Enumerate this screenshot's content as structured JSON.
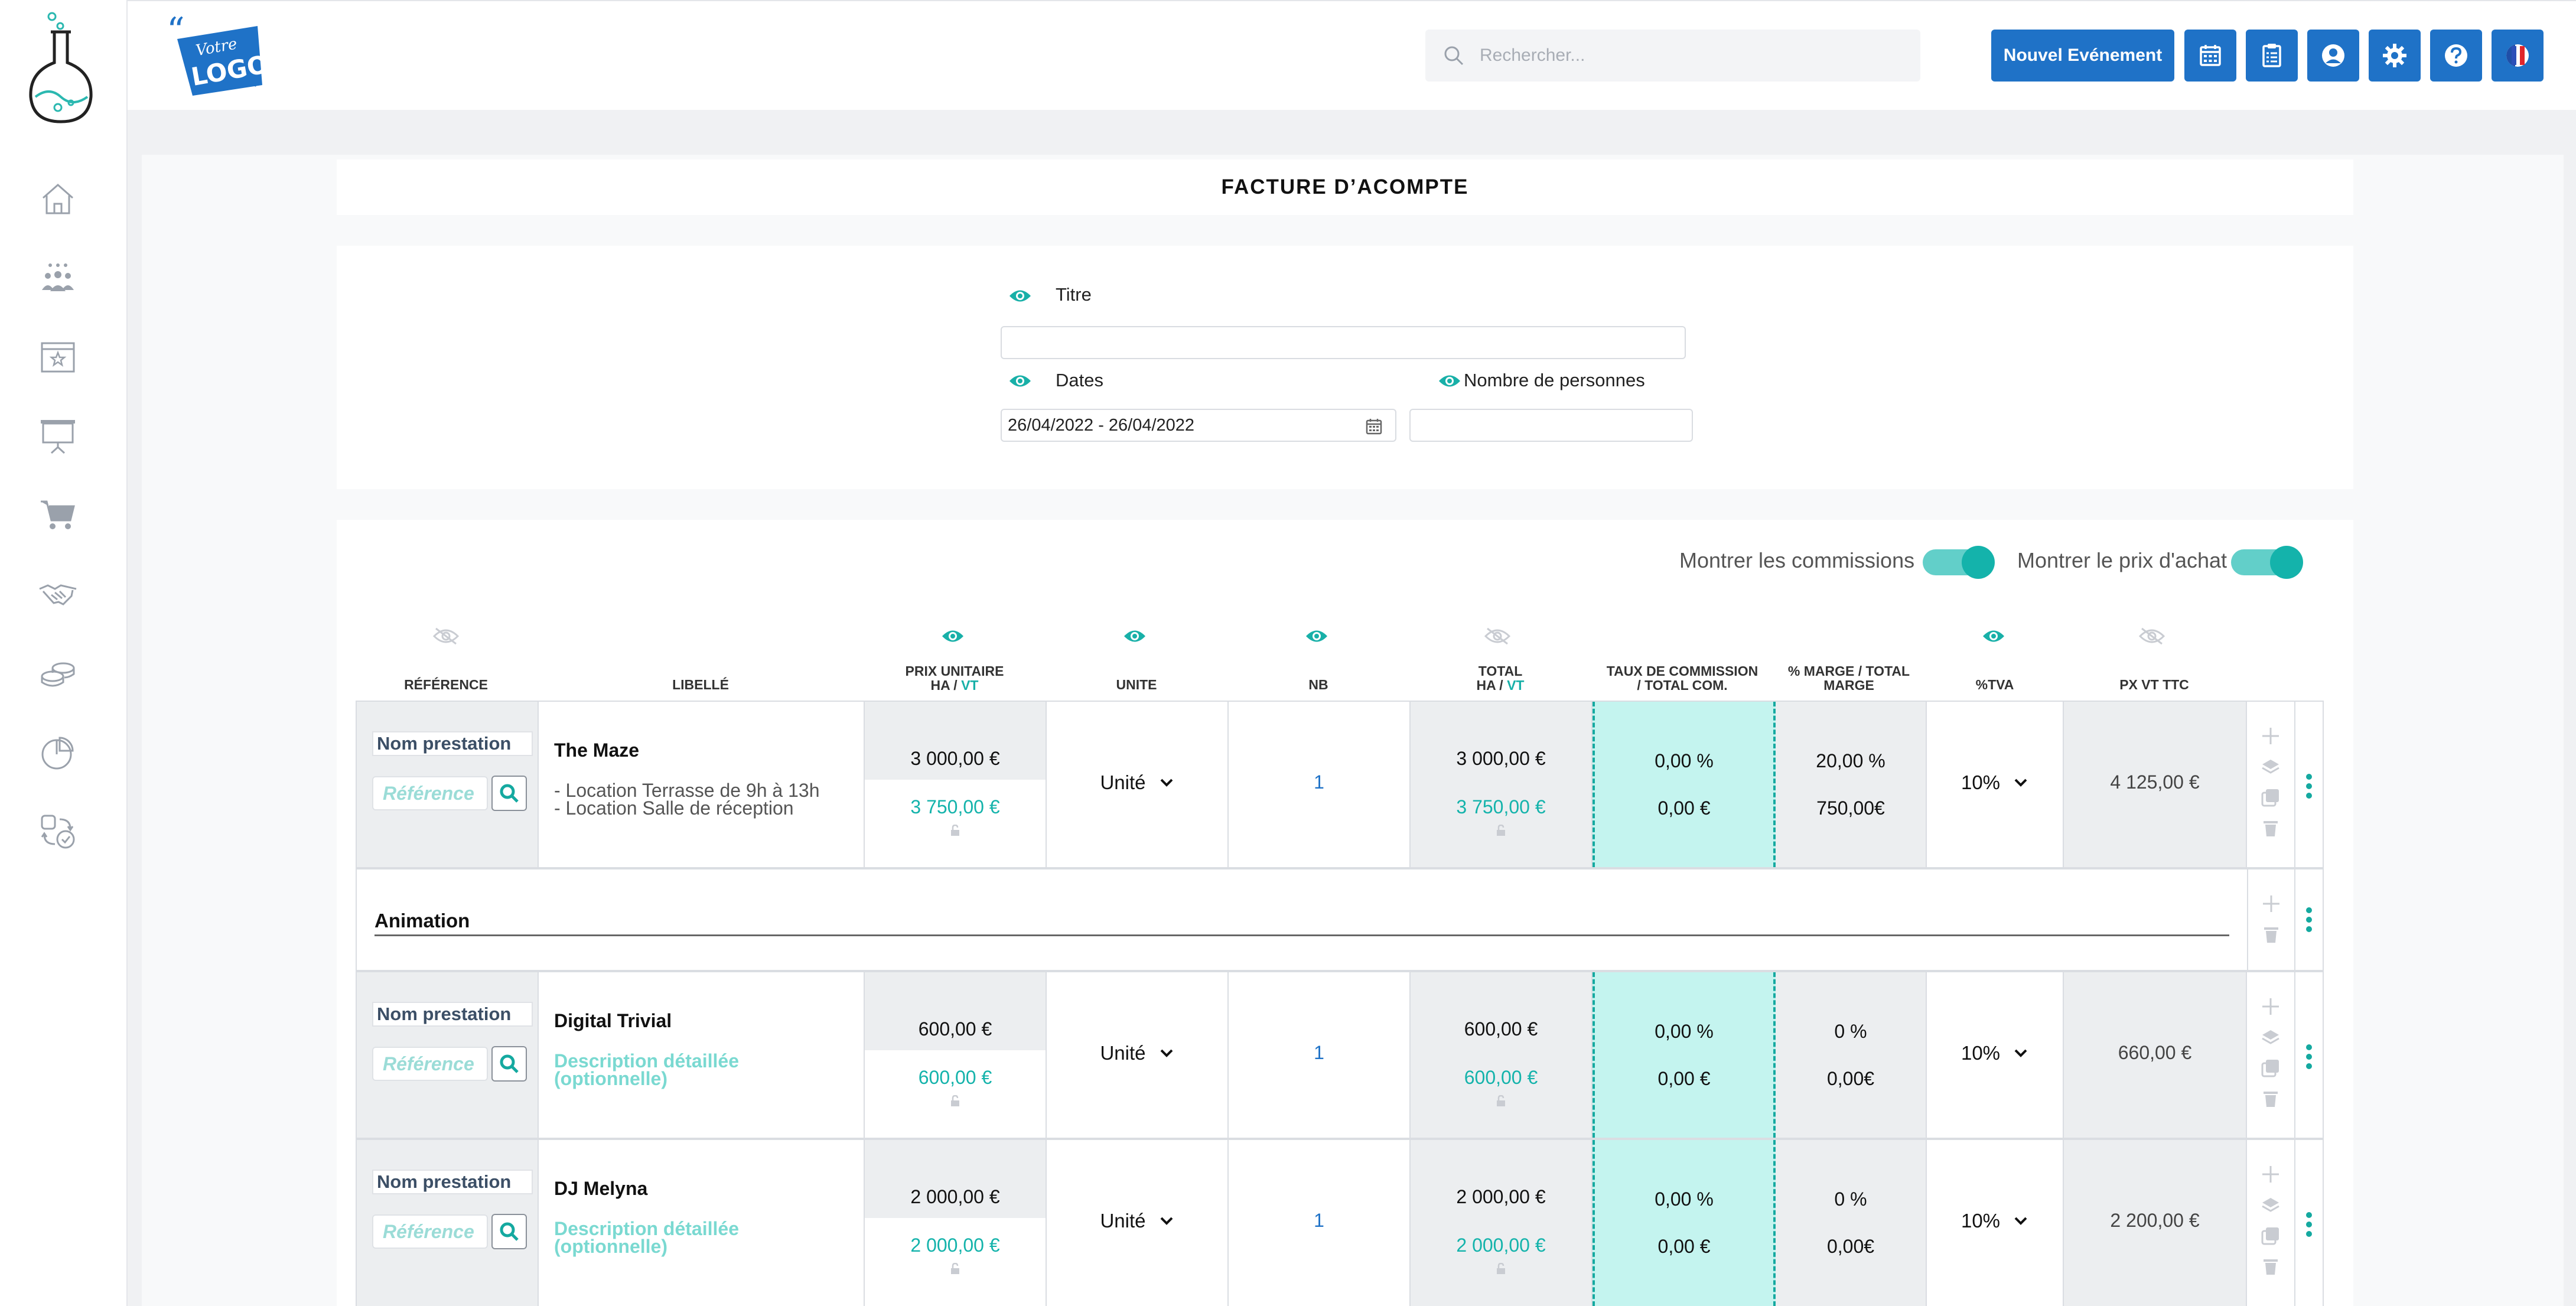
{
  "search": {
    "placeholder": "Rechercher..."
  },
  "header": {
    "new_event_label": "Nouvel Evénement"
  },
  "sidebar": {
    "items": [
      {
        "icon": "home-icon"
      },
      {
        "icon": "team-icon"
      },
      {
        "icon": "calendar-star-icon"
      },
      {
        "icon": "presentation-icon"
      },
      {
        "icon": "cart-icon"
      },
      {
        "icon": "handshake-icon"
      },
      {
        "icon": "coins-icon"
      },
      {
        "icon": "pie-chart-icon"
      },
      {
        "icon": "transfer-icon"
      }
    ]
  },
  "colors": {
    "primary": "#1f72c7",
    "accent": "#14b3ab",
    "commission_bg": "#c4f4ef"
  },
  "document": {
    "title": "FACTURE D’ACOMPTE"
  },
  "fields": {
    "titre_label": "Titre",
    "titre_value": "",
    "dates_label": "Dates",
    "dates_value": "26/04/2022 - 26/04/2022",
    "personnes_label": "Nombre de personnes",
    "personnes_value": ""
  },
  "toggles": {
    "commissions_label": "Montrer les commissions",
    "prix_achat_label": "Montrer le prix d'achat"
  },
  "columns": {
    "reference": "RÉFÉRENCE",
    "libelle": "LIBELLÉ",
    "prix_unitaire": "PRIX UNITAIRE",
    "ha": "HA",
    "vt": "VT",
    "unite": "UNITE",
    "nb": "NB",
    "total": "TOTAL",
    "taux_1": "TAUX DE COMMISSION",
    "taux_2": "/ TOTAL COM.",
    "marge_1": "% MARGE / TOTAL",
    "marge_2": "MARGE",
    "tva": "%TVA",
    "px_vt_ttc": "PX VT TTC"
  },
  "rows": [
    {
      "nom_placeholder": "Nom prestation",
      "ref_placeholder": "Référence",
      "title": "The Maze",
      "desc_1": "- Location Terrasse de 9h à 13h",
      "desc_2": "- Location Salle de réception",
      "prix_ha": "3 000,00 €",
      "prix_vt": "3 750,00 €",
      "unite": "Unité",
      "nb": "1",
      "total_ha": "3 000,00 €",
      "total_vt": "3 750,00 €",
      "taux": "0,00 %",
      "total_com": "0,00 €",
      "marge_pct": "20,00 %",
      "marge_total": "750,00€",
      "tva": "10%",
      "ttc": "4 125,00 €"
    },
    {
      "nom_placeholder": "Nom prestation",
      "ref_placeholder": "Référence",
      "title": "Digital Trivial",
      "desc_1": "Description détaillée",
      "desc_2": "(optionnelle)",
      "prix_ha": "600,00 €",
      "prix_vt": "600,00 €",
      "unite": "Unité",
      "nb": "1",
      "total_ha": "600,00 €",
      "total_vt": "600,00 €",
      "taux": "0,00 %",
      "total_com": "0,00 €",
      "marge_pct": "0 %",
      "marge_total": "0,00€",
      "tva": "10%",
      "ttc": "660,00 €"
    },
    {
      "nom_placeholder": "Nom prestation",
      "ref_placeholder": "Référence",
      "title": "DJ Melyna",
      "desc_1": "Description détaillée",
      "desc_2": "(optionnelle)",
      "prix_ha": "2 000,00 €",
      "prix_vt": "2 000,00 €",
      "unite": "Unité",
      "nb": "1",
      "total_ha": "2 000,00 €",
      "total_vt": "2 000,00 €",
      "taux": "0,00 %",
      "total_com": "0,00 €",
      "marge_pct": "0 %",
      "marge_total": "0,00€",
      "tva": "10%",
      "ttc": "2 200,00 €"
    }
  ],
  "section": {
    "title": "Animation"
  }
}
